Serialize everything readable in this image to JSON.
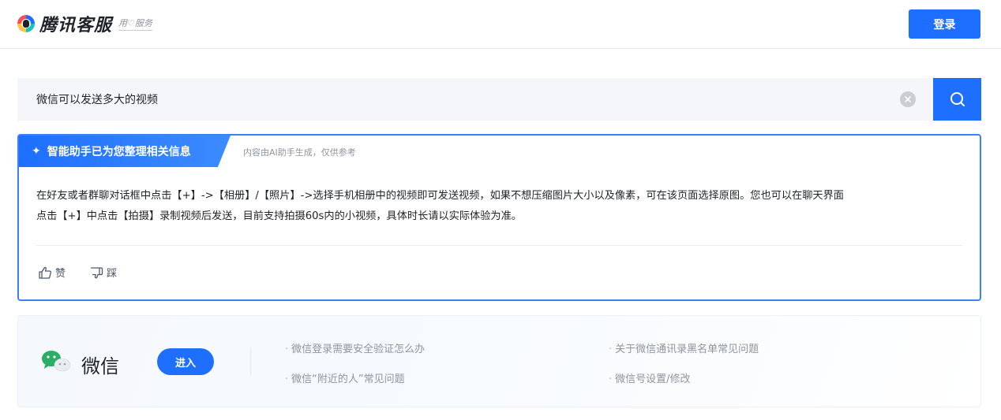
{
  "header": {
    "logo_text": "腾讯客服",
    "logo_slogan": "用♡服务",
    "login_label": "登录"
  },
  "search": {
    "value": "微信可以发送多大的视频"
  },
  "ai_answer": {
    "tag_label": "智能助手已为您整理相关信息",
    "note": "内容由AI助手生成，仅供参考",
    "body_line1": "在好友或者群聊对话框中点击【+】->【相册】/【照片】->选择手机相册中的视频即可发送视频，如果不想压缩图片大小以及像素，可在该页面选择原图。您也可以在聊天界面",
    "body_line2": "点击【+】中点击【拍摄】录制视频后发送，目前支持拍摄60s内的小视频，具体时长请以实际体验为准。",
    "like_label": "赞",
    "dislike_label": "踩"
  },
  "product": {
    "name": "微信",
    "enter_label": "进入",
    "questions": [
      "微信登录需要安全验证怎么办",
      "关于微信通讯录黑名单常见问题",
      "微信“附近的人”常见问题",
      "微信号设置/修改"
    ]
  },
  "colors": {
    "accent": "#1e6fff",
    "wechat_green": "#2aae67"
  }
}
